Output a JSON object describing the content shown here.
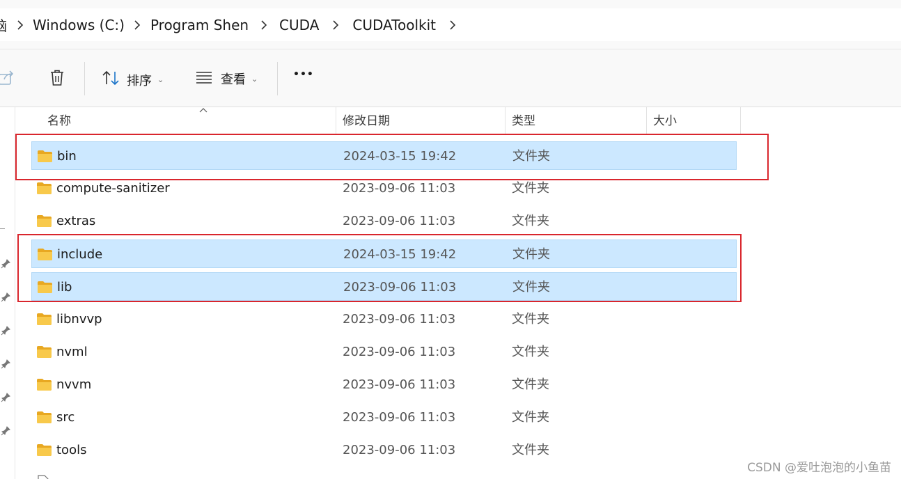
{
  "breadcrumb": {
    "items": [
      "脑",
      "Windows (C:)",
      "Program Shen",
      "CUDA",
      "CUDAToolkit"
    ]
  },
  "toolbar": {
    "sort_label": "排序",
    "view_label": "查看",
    "more_label": "•••"
  },
  "columns": {
    "name": "名称",
    "date": "修改日期",
    "type": "类型",
    "size": "大小"
  },
  "files": [
    {
      "name": "bin",
      "date": "2024-03-15 19:42",
      "type": "文件夹",
      "selected": true
    },
    {
      "name": "compute-sanitizer",
      "date": "2023-09-06 11:03",
      "type": "文件夹",
      "selected": false
    },
    {
      "name": "extras",
      "date": "2023-09-06 11:03",
      "type": "文件夹",
      "selected": false
    },
    {
      "name": "include",
      "date": "2024-03-15 19:42",
      "type": "文件夹",
      "selected": true
    },
    {
      "name": "lib",
      "date": "2023-09-06 11:03",
      "type": "文件夹",
      "selected": true
    },
    {
      "name": "libnvvp",
      "date": "2023-09-06 11:03",
      "type": "文件夹",
      "selected": false
    },
    {
      "name": "nvml",
      "date": "2023-09-06 11:03",
      "type": "文件夹",
      "selected": false
    },
    {
      "name": "nvvm",
      "date": "2023-09-06 11:03",
      "type": "文件夹",
      "selected": false
    },
    {
      "name": "src",
      "date": "2023-09-06 11:03",
      "type": "文件夹",
      "selected": false
    },
    {
      "name": "tools",
      "date": "2023-09-06 11:03",
      "type": "文件夹",
      "selected": false
    }
  ],
  "colors": {
    "selection": "#cce8ff",
    "highlight_box": "#d9262d",
    "folder": "#f8c94b"
  },
  "watermark": "CSDN @爱吐泡泡的小鱼苗"
}
